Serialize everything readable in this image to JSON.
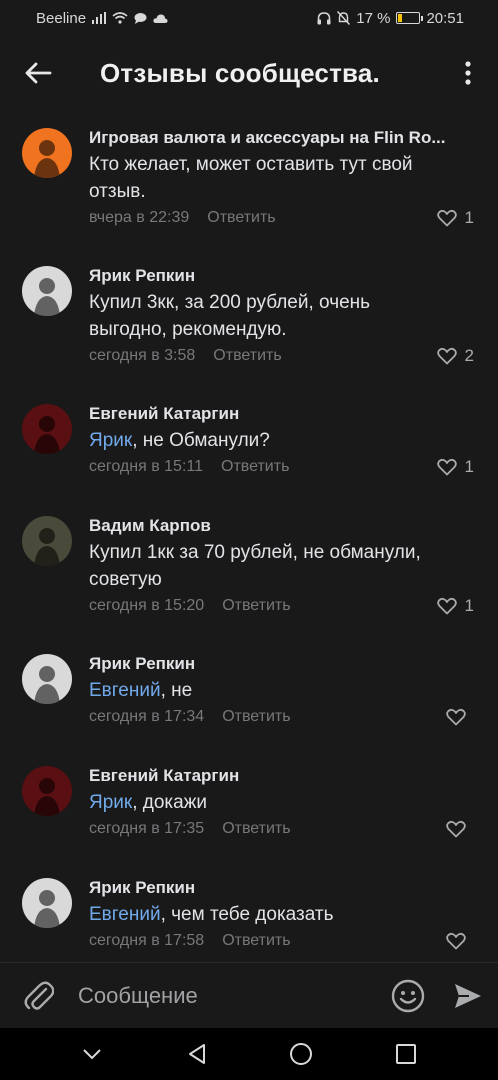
{
  "status": {
    "carrier": "Beeline",
    "battery_text": "17 %",
    "battery_level": 0.17,
    "time": "20:51"
  },
  "header": {
    "title": "Отзывы сообщества.",
    "back_icon": "arrow-left-icon",
    "more_icon": "more-vertical-icon"
  },
  "comments": [
    {
      "author": "Игровая валюта и аксессуары на Flin Ro...",
      "mention": "",
      "text": "Кто желает, может оставить тут свой отзыв.",
      "time": "вчера в 22:39",
      "reply": "Ответить",
      "likes": "1",
      "avatar_color": "#f0731f"
    },
    {
      "author": "Ярик Репкин",
      "mention": "",
      "text": "Купил 3кк, за 200 рублей, очень выгодно, рекомендую.",
      "time": "сегодня в 3:58",
      "reply": "Ответить",
      "likes": "2",
      "avatar_color": "#d9d9d9"
    },
    {
      "author": "Евгений Катаргин",
      "mention": "Ярик",
      "text": ", не Обманули?",
      "time": "сегодня в 15:11",
      "reply": "Ответить",
      "likes": "1",
      "avatar_color": "#5a0f12"
    },
    {
      "author": "Вадим Карпов",
      "mention": "",
      "text": "Купил 1кк за 70 рублей, не обманули, советую",
      "time": "сегодня в 15:20",
      "reply": "Ответить",
      "likes": "1",
      "avatar_color": "#4a4a3a"
    },
    {
      "author": "Ярик Репкин",
      "mention": "Евгений",
      "text": ", не",
      "time": "сегодня в 17:34",
      "reply": "Ответить",
      "likes": "",
      "avatar_color": "#d9d9d9"
    },
    {
      "author": "Евгений Катаргин",
      "mention": "Ярик",
      "text": ", докажи",
      "time": "сегодня в 17:35",
      "reply": "Ответить",
      "likes": "",
      "avatar_color": "#5a0f12"
    },
    {
      "author": "Ярик Репкин",
      "mention": "Евгений",
      "text": ", чем тебе доказать",
      "time": "сегодня в 17:58",
      "reply": "Ответить",
      "likes": "",
      "avatar_color": "#d9d9d9"
    }
  ],
  "composer": {
    "placeholder": "Сообщение",
    "attach_icon": "paperclip-icon",
    "emoji_icon": "smile-icon",
    "send_icon": "send-icon"
  },
  "nav": {
    "items": [
      "chevron-down-icon",
      "back-triangle-icon",
      "home-circle-icon",
      "recents-square-icon"
    ]
  }
}
